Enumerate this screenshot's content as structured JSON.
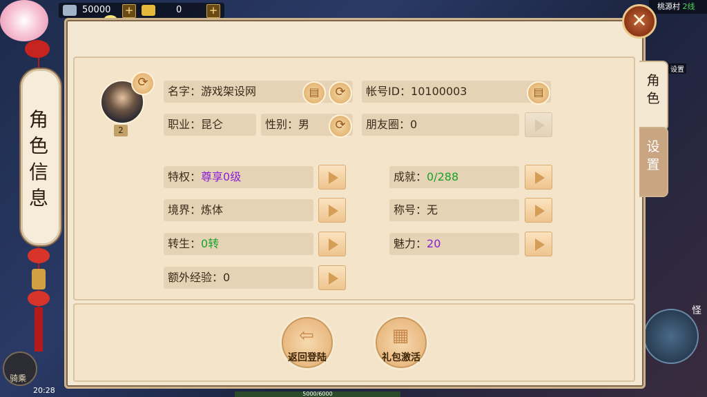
{
  "currency": {
    "silver": "50000",
    "gold": "0",
    "add_label": "+"
  },
  "banner": {
    "title": "角色信息"
  },
  "map_info": {
    "location": "桃源村",
    "line": "2线",
    "settings_hint": "设置"
  },
  "close_icon": "✕",
  "tabs": [
    {
      "label": "角色",
      "active": true
    },
    {
      "label": "设置",
      "active": false
    }
  ],
  "profile": {
    "level": "2",
    "name_label": "名字：",
    "name_value": "游戏架设网",
    "account_label": "帐号ID：",
    "account_value": "10100003",
    "job_label": "职业：",
    "job_value": "昆仑",
    "gender_label": "性别：",
    "gender_value": "男",
    "friends_label": "朋友圈：",
    "friends_value": "0"
  },
  "stats_left": [
    {
      "label": "特权：",
      "value": "尊享0级",
      "color": "purple"
    },
    {
      "label": "境界：",
      "value": "炼体",
      "color": "normal"
    },
    {
      "label": "转生：",
      "value": "0转",
      "color": "green"
    },
    {
      "label": "额外经验：",
      "value": "0",
      "color": "normal"
    }
  ],
  "stats_right": [
    {
      "label": "成就：",
      "value": "0/288",
      "color": "green"
    },
    {
      "label": "称号：",
      "value": "无",
      "color": "normal"
    },
    {
      "label": "魅力：",
      "value": "20",
      "color": "purple"
    }
  ],
  "actions": {
    "back_login": "返回登陆",
    "gift_activate": "礼包激活"
  },
  "hud": {
    "mount_label": "骑乘",
    "time": "20:28",
    "monster_label": "怪",
    "exp_bar": "5000/6000"
  },
  "colors": {
    "purple": "#8a1ed6",
    "green": "#19a12a",
    "panel": "#f4e8d3",
    "field": "#e6d3b6"
  }
}
